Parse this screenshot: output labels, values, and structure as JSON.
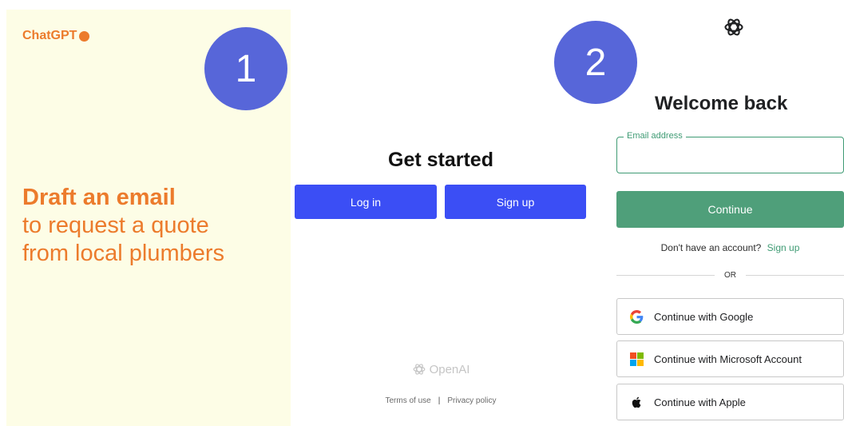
{
  "left": {
    "brand": "ChatGPT",
    "prompt_title": "Draft an email",
    "prompt_line1": "to request a quote",
    "prompt_line2": "from local plumbers"
  },
  "badges": {
    "step1": "1",
    "step2": "2"
  },
  "get_started": {
    "heading": "Get started",
    "login_label": "Log in",
    "signup_label": "Sign up",
    "logo_text": "OpenAI",
    "terms": "Terms of use",
    "separator": "|",
    "privacy": "Privacy policy"
  },
  "login": {
    "title": "Welcome back",
    "email_label": "Email address",
    "email_value": "",
    "continue_label": "Continue",
    "no_account_text": "Don't have an account?",
    "signup_link": "Sign up",
    "or_text": "OR",
    "social": [
      {
        "label": "Continue with Google",
        "icon": "google-icon"
      },
      {
        "label": "Continue with Microsoft Account",
        "icon": "microsoft-icon"
      },
      {
        "label": "Continue with Apple",
        "icon": "apple-icon"
      }
    ]
  },
  "colors": {
    "brand_orange": "#ec7b2c",
    "badge_blue": "#5766d9",
    "button_blue": "#3b4ef5",
    "accent_green": "#4f9f7a",
    "panel_yellow": "#fdfde6"
  }
}
